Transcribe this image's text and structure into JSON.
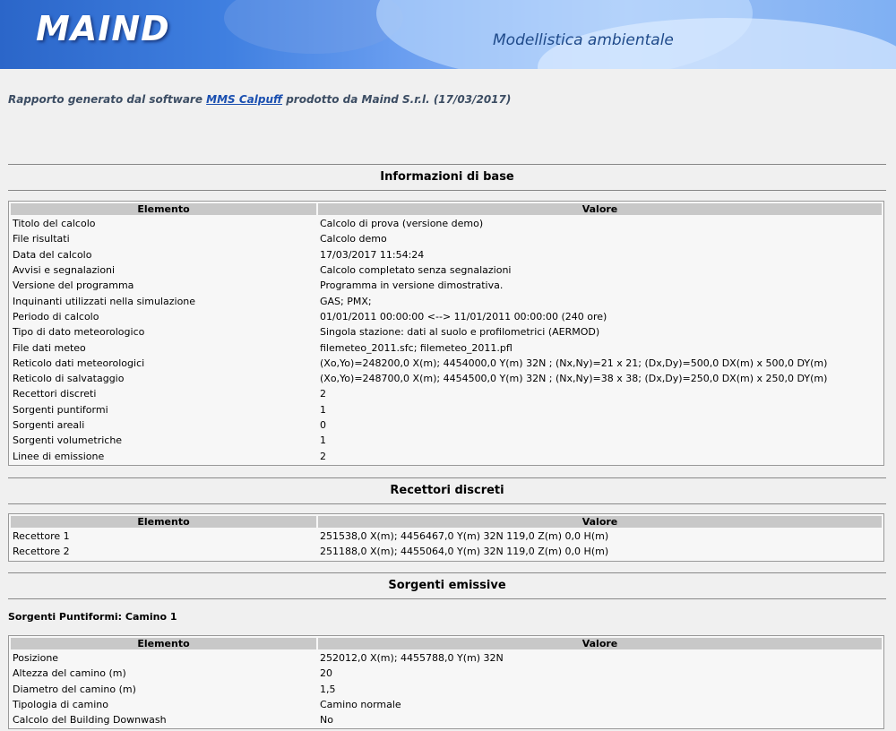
{
  "header": {
    "logo": "MAIND",
    "tagline": "Modellistica ambientale"
  },
  "report": {
    "prefix": "Rapporto generato dal software ",
    "software_link": "MMS Calpuff",
    "suffix": " prodotto da Maind S.r.l. (17/03/2017)"
  },
  "columns": {
    "element": "Elemento",
    "value": "Valore"
  },
  "sections": {
    "base_title": "Informazioni di base",
    "receptors_title": "Recettori discreti",
    "sources_title": "Sorgenti emissive",
    "point_source_subtitle": "Sorgenti Puntiformi: Camino 1"
  },
  "base_info": [
    [
      "Titolo del calcolo",
      "Calcolo di prova (versione demo)"
    ],
    [
      "File risultati",
      "Calcolo demo"
    ],
    [
      "Data del calcolo",
      "17/03/2017 11:54:24"
    ],
    [
      "Avvisi e segnalazioni",
      "Calcolo completato senza segnalazioni"
    ],
    [
      "Versione del programma",
      "Programma in versione dimostrativa."
    ],
    [
      "Inquinanti utilizzati nella simulazione",
      "GAS; PMX;"
    ],
    [
      "Periodo di calcolo",
      "01/01/2011 00:00:00 <--> 11/01/2011 00:00:00 (240 ore)"
    ],
    [
      "Tipo di dato meteorologico",
      "Singola stazione: dati al suolo e profilometrici (AERMOD)"
    ],
    [
      "File dati meteo",
      "filemeteo_2011.sfc; filemeteo_2011.pfl"
    ],
    [
      "Reticolo dati meteorologici",
      "(Xo,Yo)=248200,0 X(m); 4454000,0 Y(m) 32N ; (Nx,Ny)=21 x 21; (Dx,Dy)=500,0 DX(m) x 500,0 DY(m)"
    ],
    [
      "Reticolo di salvataggio",
      "(Xo,Yo)=248700,0 X(m); 4454500,0 Y(m) 32N ; (Nx,Ny)=38 x 38; (Dx,Dy)=250,0 DX(m) x 250,0 DY(m)"
    ],
    [
      "Recettori discreti",
      "2"
    ],
    [
      "Sorgenti puntiformi",
      "1"
    ],
    [
      "Sorgenti areali",
      "0"
    ],
    [
      "Sorgenti volumetriche",
      "1"
    ],
    [
      "Linee di emissione",
      "2"
    ]
  ],
  "receptors": [
    [
      "Recettore 1",
      "251538,0 X(m); 4456467,0 Y(m) 32N 119,0 Z(m) 0,0 H(m)"
    ],
    [
      "Recettore 2",
      "251188,0 X(m); 4455064,0 Y(m) 32N 119,0 Z(m) 0,0 H(m)"
    ]
  ],
  "point_source": [
    [
      "Posizione",
      "252012,0 X(m); 4455788,0 Y(m) 32N"
    ],
    [
      "Altezza del camino (m)",
      "20"
    ],
    [
      "Diametro del camino (m)",
      "1,5"
    ],
    [
      "Tipologia di camino",
      "Camino normale"
    ],
    [
      "Calcolo del Building Downwash",
      "No"
    ]
  ]
}
